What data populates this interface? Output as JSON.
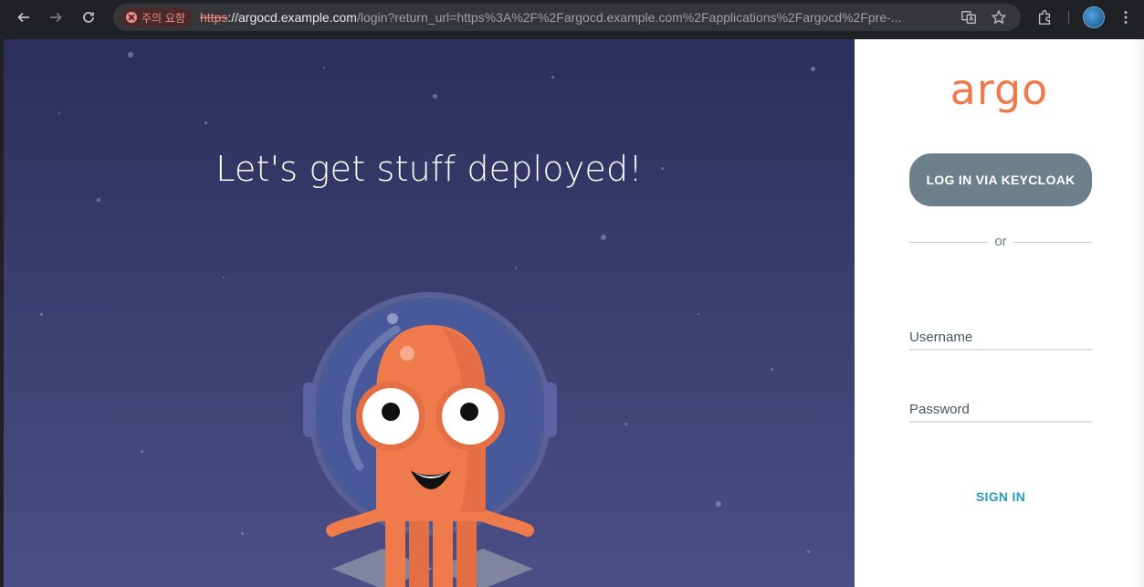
{
  "browser": {
    "security_chip": "주의 요함",
    "url_scheme": "https",
    "url_host": "://argocd.example.com",
    "url_rest": "/login?return_url=https%3A%2F%2Fargocd.example.com%2Fapplications%2Fargocd%2Fpre-...",
    "icons": [
      "back-icon",
      "forward-icon",
      "reload-icon",
      "not-secure-icon",
      "translate-icon",
      "bookmark-star-icon",
      "extensions-icon",
      "profile-avatar",
      "kebab-menu-icon"
    ]
  },
  "hero": {
    "headline": "Let's get stuff deployed!",
    "background_top": "#2d2f5a",
    "background_bottom": "#4b4f86"
  },
  "login": {
    "logo_text": "argo",
    "keycloak_label": "LOG IN VIA KEYCLOAK",
    "or_label": "or",
    "username_placeholder": "Username",
    "password_placeholder": "Password",
    "signin_label": "SIGN IN",
    "colors": {
      "brand": "#ef7b4d",
      "keycloak_button": "#6d7f8b",
      "signin": "#2a9bc0"
    }
  }
}
